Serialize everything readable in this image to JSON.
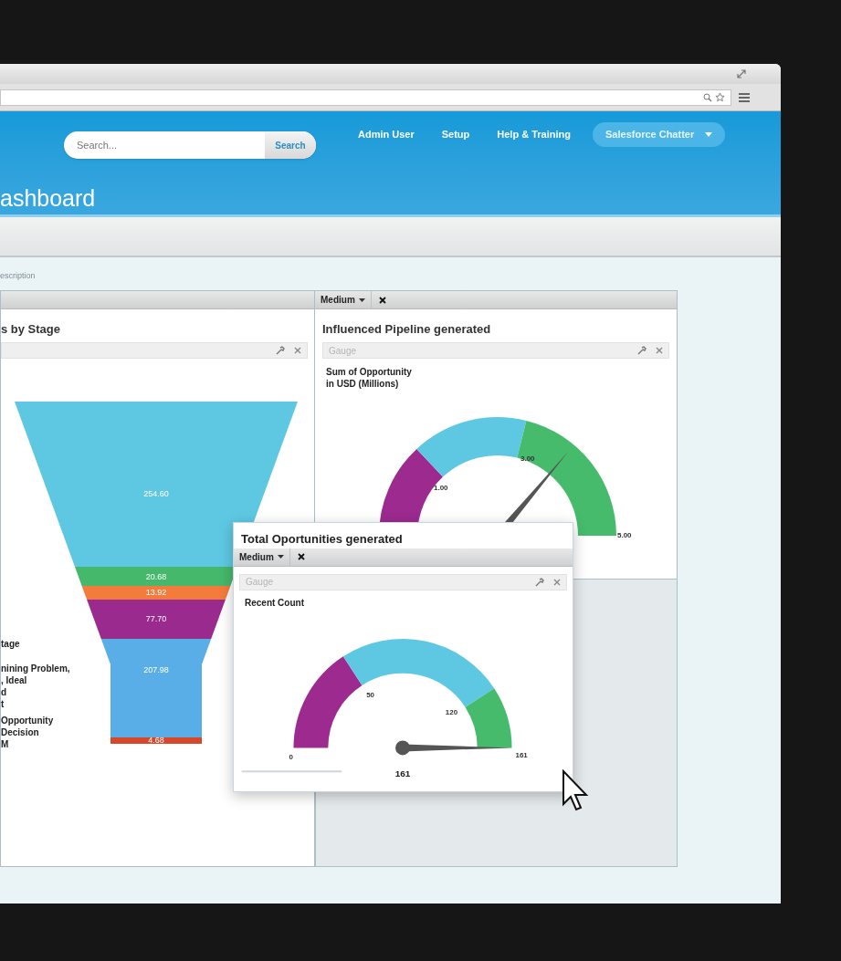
{
  "header": {
    "search": {
      "placeholder": "Search...",
      "button": "Search"
    },
    "nav": [
      {
        "label": "Admin User",
        "kind": "link"
      },
      {
        "label": "Setup",
        "kind": "link"
      },
      {
        "label": "Help & Training",
        "kind": "link"
      },
      {
        "label": "Salesforce Chatter",
        "kind": "dropdown"
      }
    ]
  },
  "page_title": "ashboard",
  "description": "escription",
  "funnel_panel": {
    "title": "s by Stage",
    "segments": [
      {
        "label": "254.60",
        "color": "#5ec8e3"
      },
      {
        "label": "20.68",
        "color": "#46b86b"
      },
      {
        "label": "13.92",
        "color": "#f37b3c"
      },
      {
        "label": "77.70",
        "color": "#9b2a8f"
      },
      {
        "label": "207.98",
        "color": "#5aaee8"
      },
      {
        "label": "4.68",
        "color": "#d9472b"
      }
    ],
    "legend": [
      "tage",
      "nining Problem,",
      ", Ideal",
      "d",
      "t",
      "Opportunity",
      "Decision",
      "M"
    ]
  },
  "pipeline_panel": {
    "size": "Medium",
    "title": "Influenced Pipeline generated",
    "component": "Gauge",
    "subtitle": "Sum of Opportunity\nin USD (Millions)",
    "ticks": [
      "1.00",
      "3.00",
      "5.00"
    ]
  },
  "popup": {
    "title": "Total Oportunities generated",
    "size": "Medium",
    "component": "Gauge",
    "subtitle": "Recent Count",
    "ticks": [
      "0",
      "50",
      "120",
      "161"
    ],
    "value": "161"
  }
}
